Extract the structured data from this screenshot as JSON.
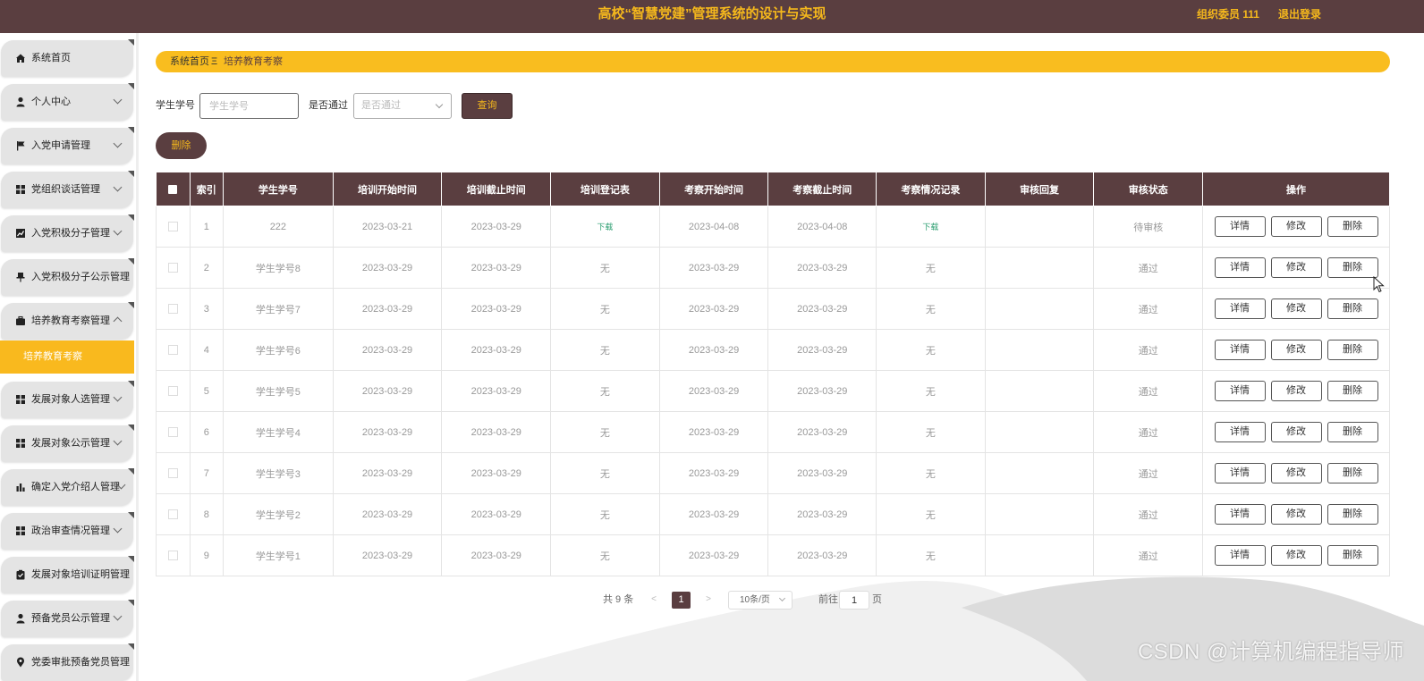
{
  "header": {
    "title": "高校“智慧党建”管理系统的设计与实现",
    "user": "组织委员 111",
    "logout": "退出登录"
  },
  "sidebar": {
    "items": [
      {
        "label": "系统首页",
        "icon": "home-icon"
      },
      {
        "label": "个人中心",
        "icon": "user-icon"
      },
      {
        "label": "入党申请管理",
        "icon": "flag-icon"
      },
      {
        "label": "党组织谈话管理",
        "icon": "grid-icon"
      },
      {
        "label": "入党积极分子管理",
        "icon": "chart-icon"
      },
      {
        "label": "入党积极分子公示管理",
        "icon": "pin-icon"
      },
      {
        "label": "培养教育考察管理",
        "icon": "briefcase-icon"
      },
      {
        "label": "发展对象人选管理",
        "icon": "grid-icon"
      },
      {
        "label": "发展对象公示管理",
        "icon": "grid-icon"
      },
      {
        "label": "确定入党介绍人管理",
        "icon": "bar-chart-icon"
      },
      {
        "label": "政治审查情况管理",
        "icon": "grid-icon"
      },
      {
        "label": "发展对象培训证明管理",
        "icon": "clipboard-icon"
      },
      {
        "label": "预备党员公示管理",
        "icon": "user-icon"
      },
      {
        "label": "党委审批预备党员管理",
        "icon": "location-icon"
      }
    ],
    "active_sub": "培养教育考察"
  },
  "breadcrumb": {
    "home": "系统首页",
    "separator": "Ξ",
    "current": "培养教育考察"
  },
  "search": {
    "student_label": "学生学号",
    "student_placeholder": "学生学号",
    "pass_label": "是否通过",
    "pass_placeholder": "是否通过",
    "query_button": "查询"
  },
  "batch_delete": "删除",
  "table": {
    "headers": [
      "索引",
      "学生学号",
      "培训开始时间",
      "培训截止时间",
      "培训登记表",
      "考察开始时间",
      "考察截止时间",
      "考察情况记录",
      "审核回复",
      "审核状态",
      "操作"
    ],
    "rows": [
      {
        "index": "1",
        "student": "222",
        "train_start": "2023-03-21",
        "train_end": "2023-03-29",
        "train_form": "下载",
        "exam_start": "2023-04-08",
        "exam_end": "2023-04-08",
        "exam_record": "下载",
        "reply": "",
        "status": "待审核"
      },
      {
        "index": "2",
        "student": "学生学号8",
        "train_start": "2023-03-29",
        "train_end": "2023-03-29",
        "train_form": "无",
        "exam_start": "2023-03-29",
        "exam_end": "2023-03-29",
        "exam_record": "无",
        "reply": "",
        "status": "通过"
      },
      {
        "index": "3",
        "student": "学生学号7",
        "train_start": "2023-03-29",
        "train_end": "2023-03-29",
        "train_form": "无",
        "exam_start": "2023-03-29",
        "exam_end": "2023-03-29",
        "exam_record": "无",
        "reply": "",
        "status": "通过"
      },
      {
        "index": "4",
        "student": "学生学号6",
        "train_start": "2023-03-29",
        "train_end": "2023-03-29",
        "train_form": "无",
        "exam_start": "2023-03-29",
        "exam_end": "2023-03-29",
        "exam_record": "无",
        "reply": "",
        "status": "通过"
      },
      {
        "index": "5",
        "student": "学生学号5",
        "train_start": "2023-03-29",
        "train_end": "2023-03-29",
        "train_form": "无",
        "exam_start": "2023-03-29",
        "exam_end": "2023-03-29",
        "exam_record": "无",
        "reply": "",
        "status": "通过"
      },
      {
        "index": "6",
        "student": "学生学号4",
        "train_start": "2023-03-29",
        "train_end": "2023-03-29",
        "train_form": "无",
        "exam_start": "2023-03-29",
        "exam_end": "2023-03-29",
        "exam_record": "无",
        "reply": "",
        "status": "通过"
      },
      {
        "index": "7",
        "student": "学生学号3",
        "train_start": "2023-03-29",
        "train_end": "2023-03-29",
        "train_form": "无",
        "exam_start": "2023-03-29",
        "exam_end": "2023-03-29",
        "exam_record": "无",
        "reply": "",
        "status": "通过"
      },
      {
        "index": "8",
        "student": "学生学号2",
        "train_start": "2023-03-29",
        "train_end": "2023-03-29",
        "train_form": "无",
        "exam_start": "2023-03-29",
        "exam_end": "2023-03-29",
        "exam_record": "无",
        "reply": "",
        "status": "通过"
      },
      {
        "index": "9",
        "student": "学生学号1",
        "train_start": "2023-03-29",
        "train_end": "2023-03-29",
        "train_form": "无",
        "exam_start": "2023-03-29",
        "exam_end": "2023-03-29",
        "exam_record": "无",
        "reply": "",
        "status": "通过"
      }
    ],
    "actions": {
      "detail": "详情",
      "edit": "修改",
      "delete": "删除"
    }
  },
  "pagination": {
    "total": "共 9 条",
    "prev": "<",
    "current_page": "1",
    "next": ">",
    "page_size": "10条/页",
    "goto_label": "前往",
    "goto_value": "1",
    "page_suffix": "页"
  },
  "watermark": "CSDN @计算机编程指导师",
  "colors": {
    "header_bg": "#5a3e40",
    "accent_gold": "#f9bd1f",
    "sidebar_item_bg": "#e4e4e4",
    "download_link": "#2a9d6f"
  }
}
